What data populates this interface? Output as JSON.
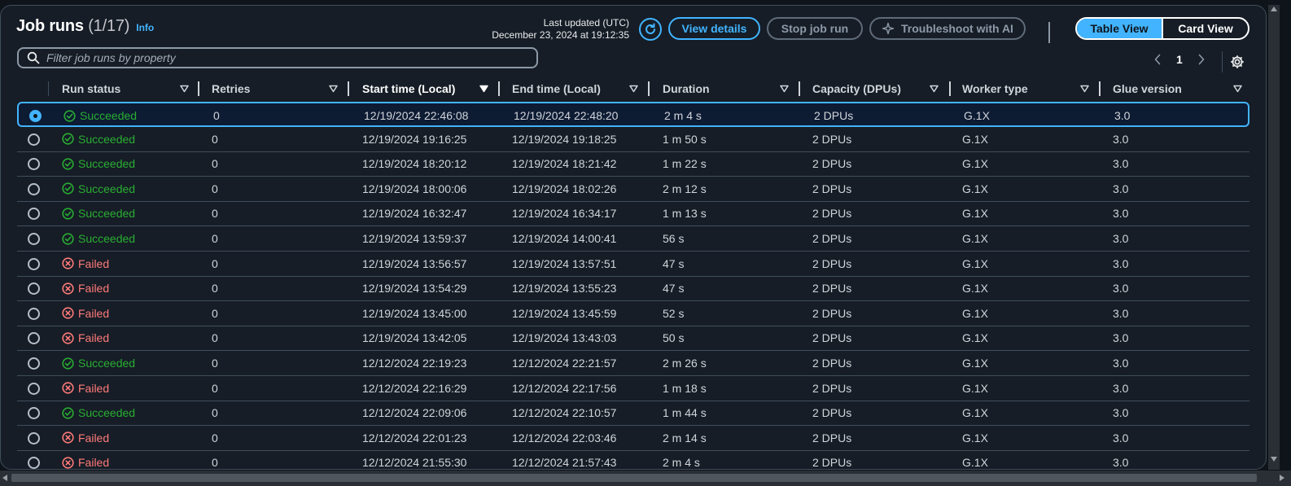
{
  "header": {
    "title": "Job runs",
    "count": "(1/17)",
    "info": "Info",
    "last_updated_label": "Last updated (UTC)",
    "last_updated_value": "December 23, 2024 at 19:12:35"
  },
  "actions": {
    "view_details": "View details",
    "stop_job_run": "Stop job run",
    "troubleshoot": "Troubleshoot with AI"
  },
  "view_toggle": {
    "table_view": "Table View",
    "card_view": "Card View",
    "selected": "Table View"
  },
  "search": {
    "placeholder": "Filter job runs by property",
    "value": ""
  },
  "pagination": {
    "current_page": "1"
  },
  "columns": {
    "run_status": "Run status",
    "retries": "Retries",
    "start_time": "Start time (Local)",
    "end_time": "End time (Local)",
    "duration": "Duration",
    "capacity": "Capacity (DPUs)",
    "worker_type": "Worker type",
    "glue_version": "Glue version"
  },
  "rows": [
    {
      "status": "Succeeded",
      "retries": "0",
      "start": "12/19/2024 22:46:08",
      "end": "12/19/2024 22:48:20",
      "duration": "2 m 4 s",
      "capacity": "2 DPUs",
      "worker": "G.1X",
      "glue": "3.0",
      "selected": true
    },
    {
      "status": "Succeeded",
      "retries": "0",
      "start": "12/19/2024 19:16:25",
      "end": "12/19/2024 19:18:25",
      "duration": "1 m 50 s",
      "capacity": "2 DPUs",
      "worker": "G.1X",
      "glue": "3.0",
      "selected": false
    },
    {
      "status": "Succeeded",
      "retries": "0",
      "start": "12/19/2024 18:20:12",
      "end": "12/19/2024 18:21:42",
      "duration": "1 m 22 s",
      "capacity": "2 DPUs",
      "worker": "G.1X",
      "glue": "3.0",
      "selected": false
    },
    {
      "status": "Succeeded",
      "retries": "0",
      "start": "12/19/2024 18:00:06",
      "end": "12/19/2024 18:02:26",
      "duration": "2 m 12 s",
      "capacity": "2 DPUs",
      "worker": "G.1X",
      "glue": "3.0",
      "selected": false
    },
    {
      "status": "Succeeded",
      "retries": "0",
      "start": "12/19/2024 16:32:47",
      "end": "12/19/2024 16:34:17",
      "duration": "1 m 13 s",
      "capacity": "2 DPUs",
      "worker": "G.1X",
      "glue": "3.0",
      "selected": false
    },
    {
      "status": "Succeeded",
      "retries": "0",
      "start": "12/19/2024 13:59:37",
      "end": "12/19/2024 14:00:41",
      "duration": "56 s",
      "capacity": "2 DPUs",
      "worker": "G.1X",
      "glue": "3.0",
      "selected": false
    },
    {
      "status": "Failed",
      "retries": "0",
      "start": "12/19/2024 13:56:57",
      "end": "12/19/2024 13:57:51",
      "duration": "47 s",
      "capacity": "2 DPUs",
      "worker": "G.1X",
      "glue": "3.0",
      "selected": false
    },
    {
      "status": "Failed",
      "retries": "0",
      "start": "12/19/2024 13:54:29",
      "end": "12/19/2024 13:55:23",
      "duration": "47 s",
      "capacity": "2 DPUs",
      "worker": "G.1X",
      "glue": "3.0",
      "selected": false
    },
    {
      "status": "Failed",
      "retries": "0",
      "start": "12/19/2024 13:45:00",
      "end": "12/19/2024 13:45:59",
      "duration": "52 s",
      "capacity": "2 DPUs",
      "worker": "G.1X",
      "glue": "3.0",
      "selected": false
    },
    {
      "status": "Failed",
      "retries": "0",
      "start": "12/19/2024 13:42:05",
      "end": "12/19/2024 13:43:03",
      "duration": "50 s",
      "capacity": "2 DPUs",
      "worker": "G.1X",
      "glue": "3.0",
      "selected": false
    },
    {
      "status": "Succeeded",
      "retries": "0",
      "start": "12/12/2024 22:19:23",
      "end": "12/12/2024 22:21:57",
      "duration": "2 m 26 s",
      "capacity": "2 DPUs",
      "worker": "G.1X",
      "glue": "3.0",
      "selected": false
    },
    {
      "status": "Failed",
      "retries": "0",
      "start": "12/12/2024 22:16:29",
      "end": "12/12/2024 22:17:56",
      "duration": "1 m 18 s",
      "capacity": "2 DPUs",
      "worker": "G.1X",
      "glue": "3.0",
      "selected": false
    },
    {
      "status": "Succeeded",
      "retries": "0",
      "start": "12/12/2024 22:09:06",
      "end": "12/12/2024 22:10:57",
      "duration": "1 m 44 s",
      "capacity": "2 DPUs",
      "worker": "G.1X",
      "glue": "3.0",
      "selected": false
    },
    {
      "status": "Failed",
      "retries": "0",
      "start": "12/12/2024 22:01:23",
      "end": "12/12/2024 22:03:46",
      "duration": "2 m 14 s",
      "capacity": "2 DPUs",
      "worker": "G.1X",
      "glue": "3.0",
      "selected": false
    },
    {
      "status": "Failed",
      "retries": "0",
      "start": "12/12/2024 21:55:30",
      "end": "12/12/2024 21:57:43",
      "duration": "2 m 4 s",
      "capacity": "2 DPUs",
      "worker": "G.1X",
      "glue": "3.0",
      "selected": false
    }
  ],
  "colors": {
    "accent": "#42b4ff",
    "success": "#29ad32",
    "error": "#ff7a7a",
    "background": "#161d26"
  }
}
